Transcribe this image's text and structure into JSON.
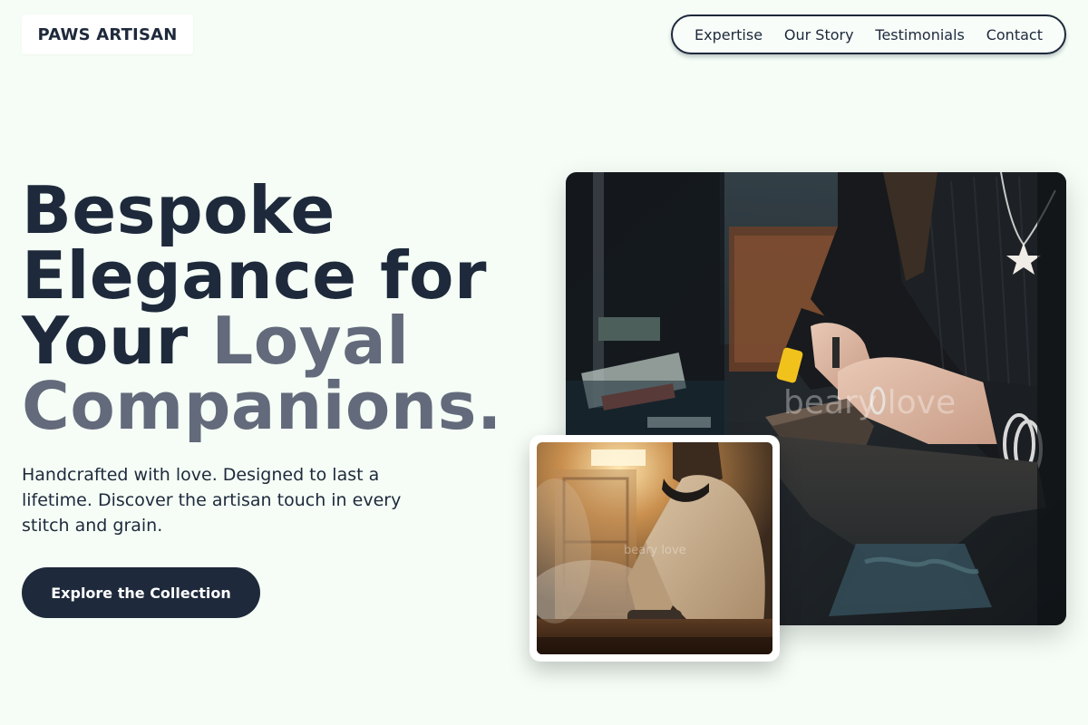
{
  "header": {
    "logo": "PAWS ARTISAN",
    "nav": [
      "Expertise",
      "Our Story",
      "Testimonials",
      "Contact"
    ]
  },
  "hero": {
    "headline": {
      "line1": "Bespoke",
      "line2": "Elegance for",
      "line3_dark": "Your ",
      "line3_muted": "Loyal",
      "line4": "Companions."
    },
    "subtitle": "Handcrafted with love. Designed to last a lifetime. Discover the artisan touch in every stitch and grain.",
    "cta_label": "Explore the Collection"
  },
  "images": {
    "main_watermark": "beary love",
    "small_watermark": "beary love"
  },
  "colors": {
    "background": "#f5fdf6",
    "primary": "#1e293b",
    "muted": "#636a7b"
  }
}
